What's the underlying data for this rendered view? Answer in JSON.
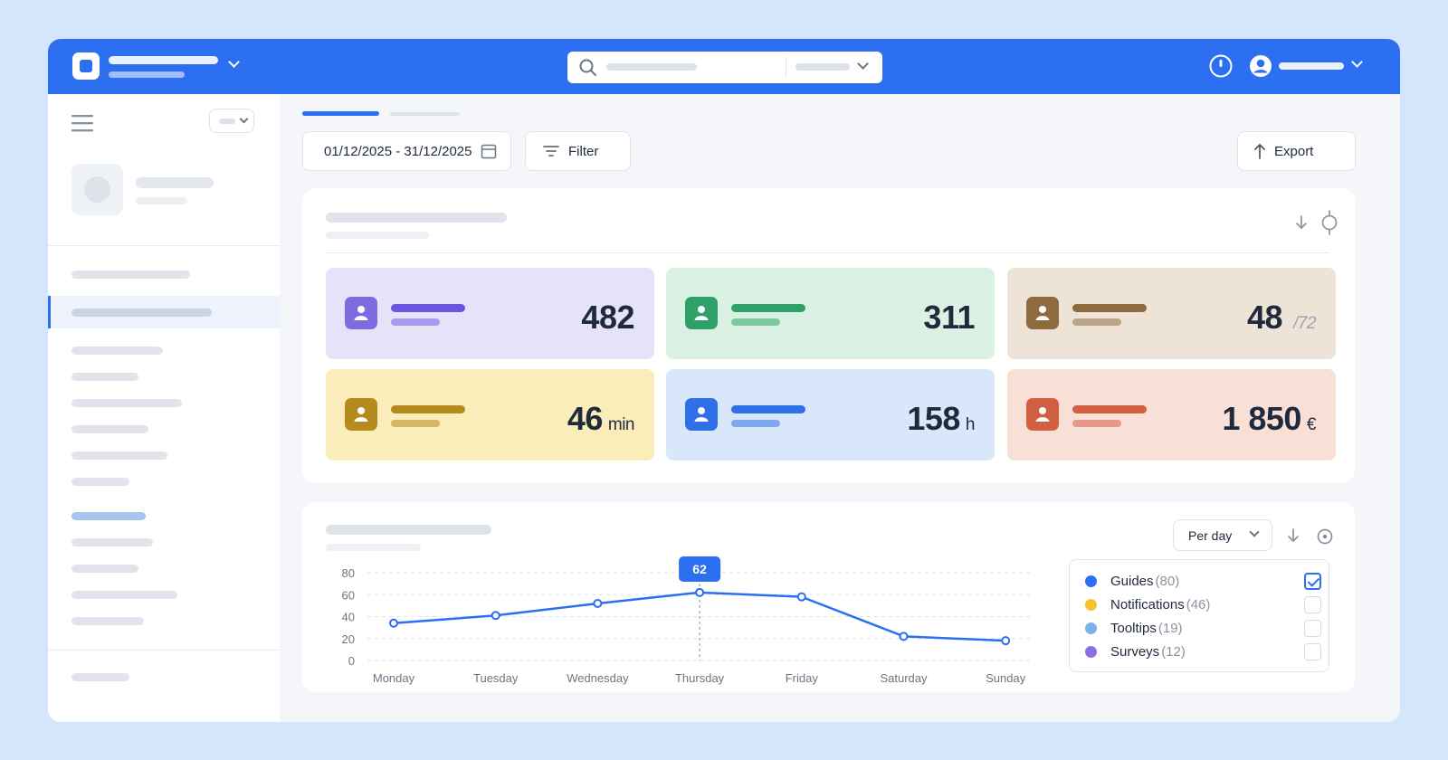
{
  "date_range": "01/12/2025 - 31/12/2025",
  "filter_label": "Filter",
  "export_label": "Export",
  "stats": [
    {
      "value": "482",
      "unit": "",
      "bg": "#e6e3f9",
      "icon_color": "#7d6ce0",
      "line1": "#6a55e0",
      "line2": "#a79cee"
    },
    {
      "value": "311",
      "unit": "",
      "bg": "#dbf1e3",
      "icon_color": "#2ea068",
      "line1": "#2ea068",
      "line2": "#7fc9a1"
    },
    {
      "value": "48",
      "unit": "/72",
      "bg": "#ede4d7",
      "icon_color": "#8e6a3e",
      "line1": "#8e6a3e",
      "line2": "#bca68b"
    },
    {
      "value": "46",
      "unit": "min",
      "bg": "#fbedb9",
      "icon_color": "#b58a1e",
      "line1": "#b58a1e",
      "line2": "#d6b565"
    },
    {
      "value": "158",
      "unit": "h",
      "bg": "#d9e7fa",
      "icon_color": "#2f6fe8",
      "line1": "#2f6fe8",
      "line2": "#7fa7f0"
    },
    {
      "value": "1 850",
      "unit": "€",
      "bg": "#f9e0d6",
      "icon_color": "#d25f3f",
      "line1": "#d25f3f",
      "line2": "#e5998a"
    }
  ],
  "period_select": "Per day",
  "legend": [
    {
      "label": "Guides",
      "count": "(80)",
      "color": "#2c6ff0",
      "checked": true
    },
    {
      "label": "Notifications",
      "count": "(46)",
      "color": "#f5c332",
      "checked": false
    },
    {
      "label": "Tooltips",
      "count": "(19)",
      "color": "#7fb0ec",
      "checked": false
    },
    {
      "label": "Surveys",
      "count": "(12)",
      "color": "#8b6fe3",
      "checked": false
    }
  ],
  "chart_data": {
    "type": "line",
    "categories": [
      "Monday",
      "Tuesday",
      "Wednesday",
      "Thursday",
      "Friday",
      "Saturday",
      "Sunday"
    ],
    "series": [
      {
        "name": "Guides",
        "values": [
          34,
          41,
          52,
          62,
          58,
          22,
          18
        ],
        "color": "#2c6ff0"
      }
    ],
    "yticks": [
      0,
      20,
      40,
      60,
      80
    ],
    "ylim": [
      0,
      80
    ],
    "highlight": {
      "category": "Thursday",
      "label": "62"
    },
    "grid": true
  }
}
